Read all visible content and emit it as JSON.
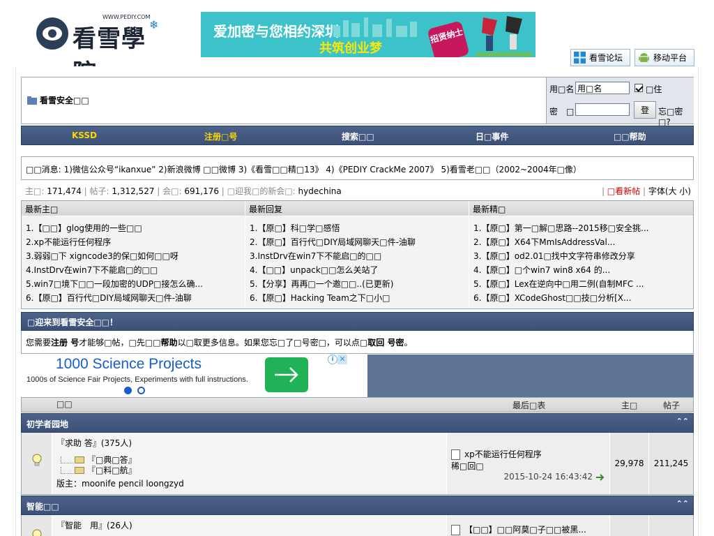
{
  "header": {
    "logo_text": "看雪學院",
    "logo_site": "WWW.PEDIY.COM",
    "banner_line1": "爱加密与您相约深圳",
    "banner_line2": "共筑创业梦",
    "banner_badge": "招贤纳士",
    "top_buttons": [
      {
        "label": "看雪论坛"
      },
      {
        "label": "移动平台"
      }
    ]
  },
  "login": {
    "site_title": "看雪安全□□",
    "username_label": "用□名",
    "username_value": "用□名",
    "remember_label": "□住",
    "password_label": "密　□",
    "login_button": "登",
    "forgot_label": "忘□密□?"
  },
  "nav": {
    "items": [
      "KSSD",
      "注册□号",
      "搜索□□",
      "日□事件",
      "□□帮助"
    ]
  },
  "announcement": {
    "prefix": "□□消息:",
    "text": "1)微信公众号“ikanxue” 2)新浪微博 □□微博 3)《看雪□□精□13》 4)《PEDIY CrackMe 2007》 5)看雪老□□（2002~2004年□像）"
  },
  "stats": {
    "topics_label": "主□:",
    "topics_value": "171,474",
    "posts_label": "帖子:",
    "posts_value": "1,312,527",
    "members_label": "会□:",
    "members_value": "691,176",
    "welcome_label": "□迎我□的新会□:",
    "welcome_value": "hydechina",
    "new_posts_link": "□看新帖",
    "font_label": "字体(大 小)"
  },
  "latest": {
    "columns": [
      {
        "header": "最新主□",
        "items": [
          "1.【□□】glog使用的一些□□",
          "2.xp不能运行任何程序",
          "3.弱弱□下 xigncode3的保□如何□□呀",
          "4.InstDrv在win7下不能启□的□□",
          "5.win7□境下□□一段加密的UDP□接怎么确...",
          "6.【原□】百行代□DIY局域网聊天□件-油聊"
        ]
      },
      {
        "header": "最新回复",
        "items": [
          "1.【原□】科□学□感悟",
          "2.【原□】百行代□DIY局域网聊天□件-油聊",
          "3.InstDrv在win7下不能启□的□□",
          "4.【□□】unpack□□怎么关站了",
          "5.【分享】再再□一个邀□□..(已更新)",
          "6.【原□】Hacking Team之下□小□"
        ]
      },
      {
        "header": "最新精□",
        "items": [
          "1.【原□】第一□解□思路--2015移□安全挑...",
          "2.【原□】X64下MmIsAddressVal...",
          "3.【原□】od2.01□找中文字符串修改分享",
          "4.【原□】□个win7 win8 x64 的...",
          "5.【原□】Lex在逆向中□用二例(自制MFC ...",
          "6.【原□】XCodeGhost□□技□分析[X..."
        ]
      }
    ]
  },
  "welcome": {
    "title": "□迎来到看雪安全□□！",
    "text_before": "您需要",
    "register_link": "注册 号",
    "text_mid1": "才能够□帖，□先□□",
    "help_link": "帮助",
    "text_mid2": "以□取更多信息。如果您忘□了□号密□，可以点□",
    "retrieve_link": "取回 号密",
    "text_end": "。"
  },
  "ad": {
    "headline": "1000 Science Projects",
    "subline": "1000s of Science Fair Projects, Experiments with full instructions."
  },
  "forum_header": {
    "forum_col": "□□",
    "last_col": "最后□表",
    "topics_col": "主□",
    "posts_col": "帖子"
  },
  "categories": [
    {
      "title": "初学者园地",
      "forums": [
        {
          "name": "『求助 答』",
          "online": "(375人)",
          "subforums": [
            "『□典□答』",
            "『□料□航』"
          ],
          "moderators_label": "版主：",
          "moderators": "moonife pencil loongzyd",
          "last_title": "xp不能运行任何程序",
          "last_by": "稀□回□",
          "last_time": "2015-10-24 16:43:42",
          "topics": "29,978",
          "posts": "211,245"
        }
      ]
    },
    {
      "title": "智能□□",
      "forums": [
        {
          "name": "『智能　用』",
          "online": "(26人)",
          "subforums": [],
          "moderators_label": "",
          "moderators": "",
          "last_title": "【□□】□□阿莫□子□□被黑...",
          "last_by": "",
          "last_time": "",
          "topics": "",
          "posts": ""
        }
      ]
    }
  ],
  "colors": {
    "nav_bar": "#41567d",
    "accent_yellow": "#ffd700",
    "link_red": "#cc0000"
  }
}
